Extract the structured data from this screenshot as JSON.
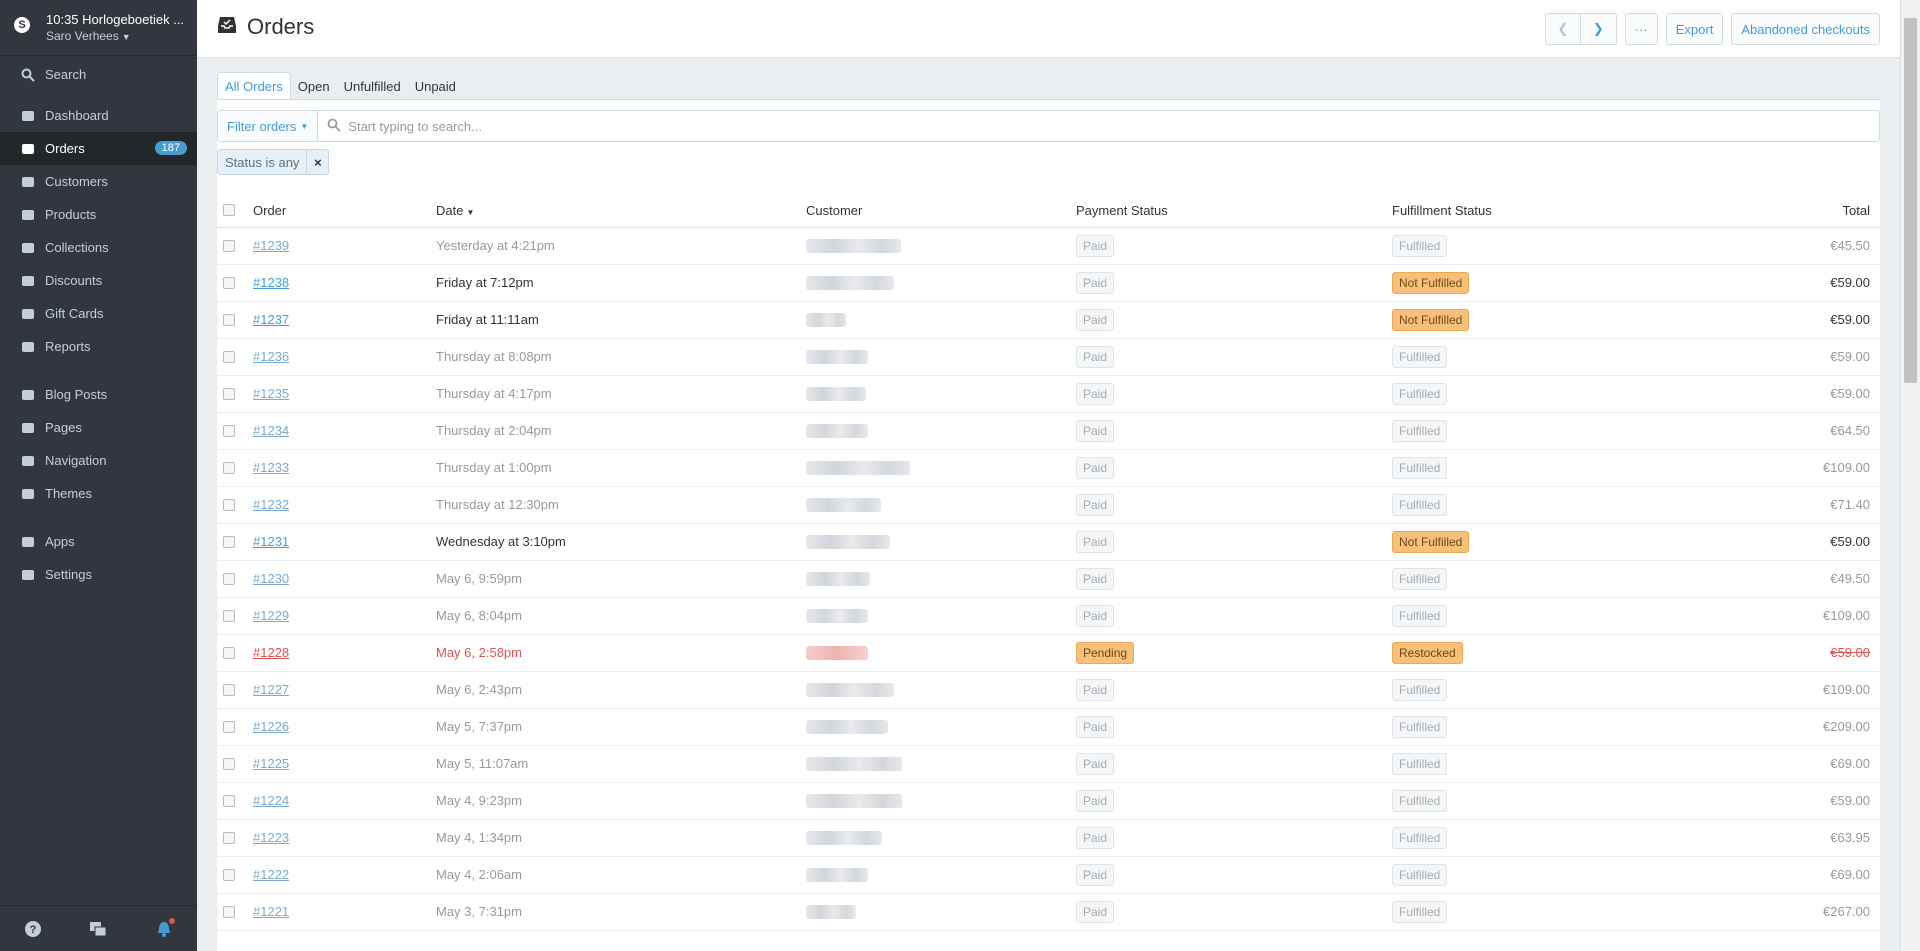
{
  "store": {
    "name": "10:35 Horlogeboetiek ...",
    "user": "Saro Verhees",
    "logo_letter": "S"
  },
  "nav": {
    "search": "Search",
    "main": [
      {
        "label": "Dashboard",
        "icon": "home-icon"
      },
      {
        "label": "Orders",
        "icon": "inbox-icon",
        "badge": "187",
        "active": true
      },
      {
        "label": "Customers",
        "icon": "users-icon"
      },
      {
        "label": "Products",
        "icon": "tag-icon"
      },
      {
        "label": "Collections",
        "icon": "collections-icon"
      },
      {
        "label": "Discounts",
        "icon": "discount-icon"
      },
      {
        "label": "Gift Cards",
        "icon": "gift-icon"
      },
      {
        "label": "Reports",
        "icon": "reports-icon"
      }
    ],
    "content": [
      {
        "label": "Blog Posts",
        "icon": "blog-icon"
      },
      {
        "label": "Pages",
        "icon": "pages-icon"
      },
      {
        "label": "Navigation",
        "icon": "navigation-icon"
      },
      {
        "label": "Themes",
        "icon": "themes-icon"
      }
    ],
    "system": [
      {
        "label": "Apps",
        "icon": "apps-icon"
      },
      {
        "label": "Settings",
        "icon": "gear-icon"
      }
    ]
  },
  "header": {
    "title": "Orders",
    "more": "···",
    "export": "Export",
    "abandoned": "Abandoned checkouts"
  },
  "tabs": [
    "All Orders",
    "Open",
    "Unfulfilled",
    "Unpaid"
  ],
  "filter": {
    "button": "Filter orders",
    "placeholder": "Start typing to search...",
    "tag": "Status is any"
  },
  "table": {
    "headers": {
      "order": "Order",
      "date": "Date",
      "customer": "Customer",
      "payment": "Payment Status",
      "fulfillment": "Fulfillment Status",
      "total": "Total"
    },
    "rows": [
      {
        "order": "#1239",
        "date": "Yesterday at 4:21pm",
        "payment": "Paid",
        "fulfillment": "Fulfilled",
        "total": "€45.50",
        "state": "dim"
      },
      {
        "order": "#1238",
        "date": "Friday at 7:12pm",
        "payment": "Paid",
        "fulfillment": "Not Fulfilled",
        "total": "€59.00",
        "state": "bright"
      },
      {
        "order": "#1237",
        "date": "Friday at 11:11am",
        "payment": "Paid",
        "fulfillment": "Not Fulfilled",
        "total": "€59.00",
        "state": "bright"
      },
      {
        "order": "#1236",
        "date": "Thursday at 8:08pm",
        "payment": "Paid",
        "fulfillment": "Fulfilled",
        "total": "€59.00",
        "state": "dim"
      },
      {
        "order": "#1235",
        "date": "Thursday at 4:17pm",
        "payment": "Paid",
        "fulfillment": "Fulfilled",
        "total": "€59.00",
        "state": "dim"
      },
      {
        "order": "#1234",
        "date": "Thursday at 2:04pm",
        "payment": "Paid",
        "fulfillment": "Fulfilled",
        "total": "€64.50",
        "state": "dim"
      },
      {
        "order": "#1233",
        "date": "Thursday at 1:00pm",
        "payment": "Paid",
        "fulfillment": "Fulfilled",
        "total": "€109.00",
        "state": "dim"
      },
      {
        "order": "#1232",
        "date": "Thursday at 12:30pm",
        "payment": "Paid",
        "fulfillment": "Fulfilled",
        "total": "€71.40",
        "state": "dim"
      },
      {
        "order": "#1231",
        "date": "Wednesday at 3:10pm",
        "payment": "Paid",
        "fulfillment": "Not Fulfilled",
        "total": "€59.00",
        "state": "bright"
      },
      {
        "order": "#1230",
        "date": "May 6, 9:59pm",
        "payment": "Paid",
        "fulfillment": "Fulfilled",
        "total": "€49.50",
        "state": "dim"
      },
      {
        "order": "#1229",
        "date": "May 6, 8:04pm",
        "payment": "Paid",
        "fulfillment": "Fulfilled",
        "total": "€109.00",
        "state": "dim"
      },
      {
        "order": "#1228",
        "date": "May 6, 2:58pm",
        "payment": "Pending",
        "fulfillment": "Restocked",
        "total": "€59.00",
        "state": "alert"
      },
      {
        "order": "#1227",
        "date": "May 6, 2:43pm",
        "payment": "Paid",
        "fulfillment": "Fulfilled",
        "total": "€109.00",
        "state": "dim"
      },
      {
        "order": "#1226",
        "date": "May 5, 7:37pm",
        "payment": "Paid",
        "fulfillment": "Fulfilled",
        "total": "€209.00",
        "state": "dim"
      },
      {
        "order": "#1225",
        "date": "May 5, 11:07am",
        "payment": "Paid",
        "fulfillment": "Fulfilled",
        "total": "€69.00",
        "state": "dim"
      },
      {
        "order": "#1224",
        "date": "May 4, 9:23pm",
        "payment": "Paid",
        "fulfillment": "Fulfilled",
        "total": "€59.00",
        "state": "dim"
      },
      {
        "order": "#1223",
        "date": "May 4, 1:34pm",
        "payment": "Paid",
        "fulfillment": "Fulfilled",
        "total": "€63.95",
        "state": "dim"
      },
      {
        "order": "#1222",
        "date": "May 4, 2:06am",
        "payment": "Paid",
        "fulfillment": "Fulfilled",
        "total": "€69.00",
        "state": "dim"
      },
      {
        "order": "#1221",
        "date": "May 3, 7:31pm",
        "payment": "Paid",
        "fulfillment": "Fulfilled",
        "total": "€267.00",
        "state": "dim"
      }
    ]
  }
}
